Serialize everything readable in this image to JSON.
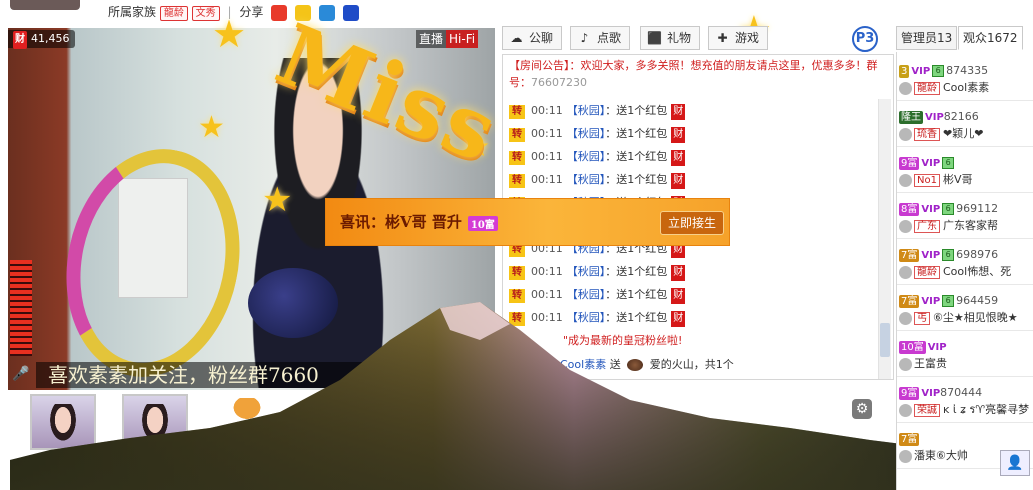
{
  "header": {
    "family_label": "所属家族",
    "badges": [
      "龍龄",
      "文秀"
    ],
    "share_label": "分享",
    "share_icons": [
      "weibo-icon",
      "qzone-icon",
      "tencent-icon",
      "paw-icon"
    ]
  },
  "video": {
    "money_label": "财",
    "money_value": "41,456",
    "live_label": "直播",
    "hifi_label": "Hi-Fi",
    "caption": "喜欢素素加关注，粉丝群7660",
    "overlay_text": "Miss"
  },
  "chat": {
    "tabs": [
      {
        "label": "公聊",
        "icon": "chat-icon"
      },
      {
        "label": "点歌",
        "icon": "music-icon"
      },
      {
        "label": "礼物",
        "icon": "gift-icon"
      },
      {
        "label": "游戏",
        "icon": "gamepad-icon"
      }
    ],
    "page_badge": "P3",
    "notice_text": "【房间公告】：欢迎大家，多多关照！想充值的朋友请点这里，优惠多多！群号：",
    "notice_group": "76607230",
    "messages": [
      {
        "badge": "转",
        "time": "00:11",
        "user": "【秋园】",
        "text": "：送1个红包",
        "tag": "财"
      },
      {
        "badge": "转",
        "time": "00:11",
        "user": "【秋园】",
        "text": "：送1个红包",
        "tag": "财"
      },
      {
        "badge": "转",
        "time": "00:11",
        "user": "【秋园】",
        "text": "：送1个红包",
        "tag": "财"
      },
      {
        "badge": "转",
        "time": "00:11",
        "user": "【秋园】",
        "text": "：送1个红包",
        "tag": "财"
      },
      {
        "badge": "转",
        "time": "00:11",
        "user": "【秋园】",
        "text": "：送1个红包",
        "tag": "财"
      },
      {
        "badge": "转",
        "time": "00:11",
        "user": "【秋园】",
        "text": "：送1个红包",
        "tag": "财"
      },
      {
        "badge": "转",
        "time": "00:11",
        "user": "【秋园】",
        "text": "：送1个红包",
        "tag": "财"
      },
      {
        "badge": "转",
        "time": "00:11",
        "user": "【秋园】",
        "text": "：送1个红包",
        "tag": "财"
      },
      {
        "badge": "转",
        "time": "00:11",
        "user": "【秋园】",
        "text": "：送1个红包",
        "tag": "财"
      },
      {
        "badge": "转",
        "time": "00:11",
        "user": "【秋园】",
        "text": "：送1个红包",
        "tag": "财"
      }
    ],
    "crown_text": "\"成为最新的皇冠粉丝啦!",
    "gift_line": {
      "user": "Cool素素",
      "verb": "送",
      "item": "爱的火山，共1个"
    }
  },
  "banner": {
    "text": "喜讯：彬V哥 晋升",
    "level": "10富",
    "button": "立即接生"
  },
  "user_tabs": [
    "管理员13",
    "观众1672"
  ],
  "users": [
    {
      "level": "3",
      "level_color": "#c8a018",
      "vip": "VIP",
      "gem": "6",
      "id": "874335",
      "family": "龍龄",
      "name": "Cool素素"
    },
    {
      "level": "隆王",
      "level_color": "#2c6e2c",
      "vip": "VIP",
      "gem": "",
      "id": "82166",
      "family": "琉香",
      "name": "❤颖儿❤"
    },
    {
      "level": "9富",
      "level_color": "#c83ad0",
      "vip": "VIP",
      "gem": "6",
      "id": "",
      "family": "No1",
      "name": "彬V哥"
    },
    {
      "level": "8富",
      "level_color": "#c83ad0",
      "vip": "VIP",
      "gem": "6",
      "id": "969112",
      "family": "广东",
      "name": "广东客家帮"
    },
    {
      "level": "7富",
      "level_color": "#d08a16",
      "vip": "VIP",
      "gem": "6",
      "id": "698976",
      "family": "龍龄",
      "name": "Cool怖想、死"
    },
    {
      "level": "7富",
      "level_color": "#d08a16",
      "vip": "VIP",
      "gem": "6",
      "id": "964459",
      "family": "丐",
      "name": "⑥尘★相见恨晚★"
    },
    {
      "level": "10富",
      "level_color": "#c83ad0",
      "vip": "VIP",
      "gem": "",
      "id": "",
      "family": "",
      "name": "王富贵"
    },
    {
      "level": "9富",
      "level_color": "#c83ad0",
      "vip": "VIP",
      "gem": "",
      "id": "870444",
      "family": "荣誠",
      "name": "ĸ ἰ ʑ ร♈亮馨寻梦"
    },
    {
      "level": "7富",
      "level_color": "#d08a16",
      "vip": "",
      "gem": "",
      "id": "",
      "family": "",
      "name": "潘東⑥大帅"
    }
  ]
}
